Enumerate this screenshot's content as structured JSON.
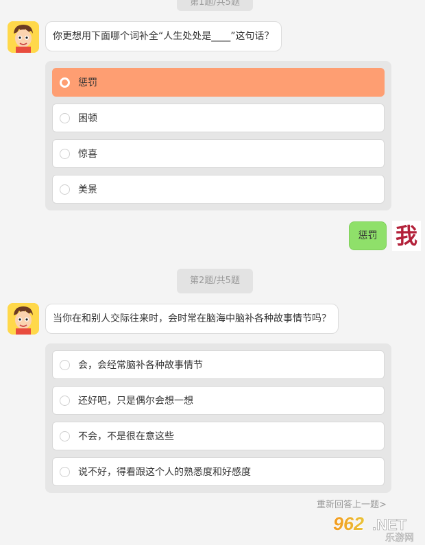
{
  "q1": {
    "counter": "第1题/共5题",
    "question": "你更想用下面哪个词补全“人生处处是____”这句话？",
    "options": [
      "惩罚",
      "困顿",
      "惊喜",
      "美景"
    ],
    "selected_index": 0
  },
  "user_reply": {
    "text": "惩罚",
    "avatar_text": "我"
  },
  "q2": {
    "counter": "第2题/共5题",
    "question": "当你在和别人交际往来时，会时常在脑海中脑补各种故事情节吗？",
    "options": [
      "会，会经常脑补各种故事情节",
      "还好吧，只是偶尔会想一想",
      "不会，不是很在意这些",
      "说不好，得看跟这个人的熟悉度和好感度"
    ]
  },
  "redo_link": "重新回答上一题>",
  "watermark": {
    "main": "962.NET",
    "sub": "乐游网"
  },
  "colors": {
    "selected_option": "#fe9e72",
    "user_bubble": "#8fe06a",
    "avatar_bg": "#ffd84a",
    "user_avatar_text": "#b3213a"
  }
}
